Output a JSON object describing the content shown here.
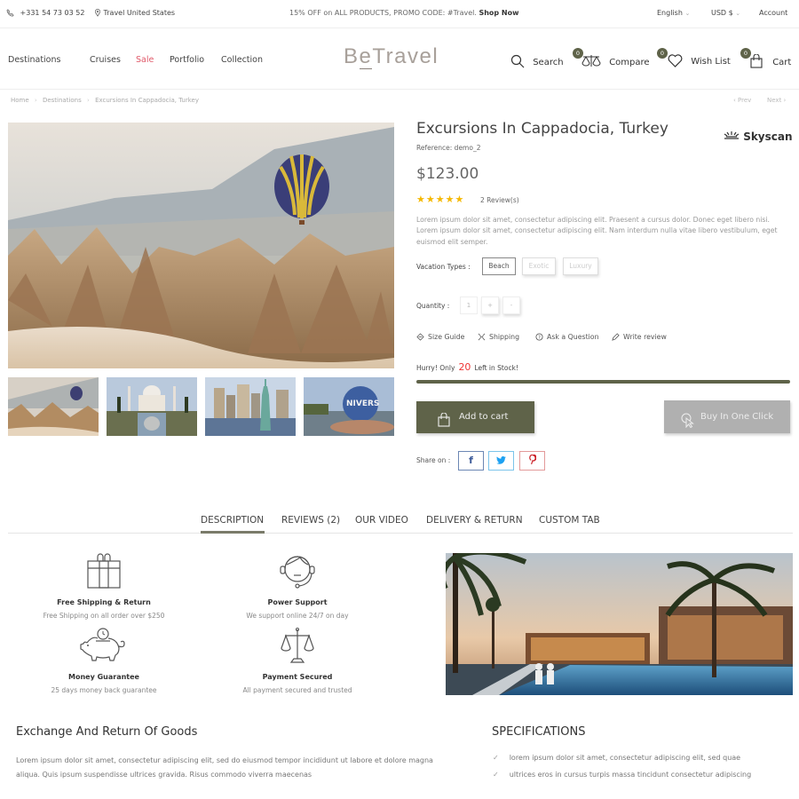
{
  "topbar": {
    "phone": "+331 54 73 03 52",
    "location": "Travel United States",
    "promo_text": "15% OFF on ALL PRODUCTS, PROMO CODE: #Travel.",
    "promo_link": "Shop Now",
    "language": "English",
    "currency": "USD $",
    "account": "Account"
  },
  "header": {
    "nav": [
      "Destinations",
      "Cruises",
      "Sale",
      "Portfolio",
      "Collection"
    ],
    "logo_prefix": "B",
    "logo_e": "e",
    "logo_rest": "Travel",
    "search": "Search",
    "compare": "Compare",
    "compare_count": "0",
    "wishlist": "Wish List",
    "wishlist_count": "0",
    "cart": "Cart",
    "cart_count": "0",
    "sale_color": "#e05a6a"
  },
  "breadcrumb": {
    "items": [
      "Home",
      "Destinations",
      "Excursions In Cappadocia, Turkey"
    ],
    "prev": "‹ Prev",
    "next": "Next ›"
  },
  "product": {
    "title": "Excursions In Cappadocia, Turkey",
    "reference": "Reference: demo_2",
    "brand": "Skyscan",
    "price": "$123.00",
    "rating": 5,
    "stars": "★★★★★",
    "reviews": "2 Review(s)",
    "description": "Lorem ipsum dolor sit amet, consectetur adipiscing elit. Praesent a cursus dolor. Donec eget libero nisi. Lorem ipsum dolor sit amet, consectetur adipiscing elit. Nam interdum nulla vitae libero vestibulum, eget euismod elit semper.",
    "vacation_label": "Vacation Types :",
    "vacation_types": [
      "Beach",
      "Exotic",
      "Luxury"
    ],
    "vacation_selected": "Beach",
    "quantity_label": "Quantity :",
    "quantity": "1",
    "plus": "+",
    "minus": "-",
    "links": [
      "Size Guide",
      "Shipping",
      "Ask a Question",
      "Write review"
    ],
    "stock_prefix": "Hurry! Only",
    "stock_count": "20",
    "stock_suffix": "Left in Stock!",
    "stock_fill_percent": 100,
    "add_to_cart": "Add to cart",
    "buy_one_click": "Buy In One Click",
    "share_label": "Share on :",
    "share": [
      "f",
      "t",
      "p"
    ],
    "accent_color": "#5f6349"
  },
  "tabs": {
    "items": [
      "DESCRIPTION",
      "REVIEWS (2)",
      "OUR VIDEO",
      "DELIVERY & RETURN",
      "CUSTOM TAB"
    ],
    "active": "DESCRIPTION"
  },
  "features": [
    {
      "title": "Free Shipping & Return",
      "subtitle": "Free Shipping on all order over $250",
      "icon": "gift-icon"
    },
    {
      "title": "Power Support",
      "subtitle": "We support online 24/7 on day",
      "icon": "headset-icon"
    },
    {
      "title": "Money Guarantee",
      "subtitle": "25 days money back guarantee",
      "icon": "piggy-bank-icon"
    },
    {
      "title": "Payment Secured",
      "subtitle": "All payment secured and trusted",
      "icon": "scales-icon"
    }
  ],
  "exchange": {
    "title": "Exchange And Return Of Goods",
    "text": "Lorem ipsum dolor sit amet, consectetur adipiscing elit, sed do eiusmod tempor incididunt ut labore et dolore magna aliqua. Quis ipsum suspendisse ultrices gravida. Risus commodo viverra maecenas"
  },
  "specifications": {
    "title": "SPECIFICATIONS",
    "items": [
      "lorem ipsum dolor sit amet, consectetur adipiscing elit, sed quae",
      "ultrices eros in cursus turpis massa tincidunt consectetur adipiscing"
    ]
  }
}
